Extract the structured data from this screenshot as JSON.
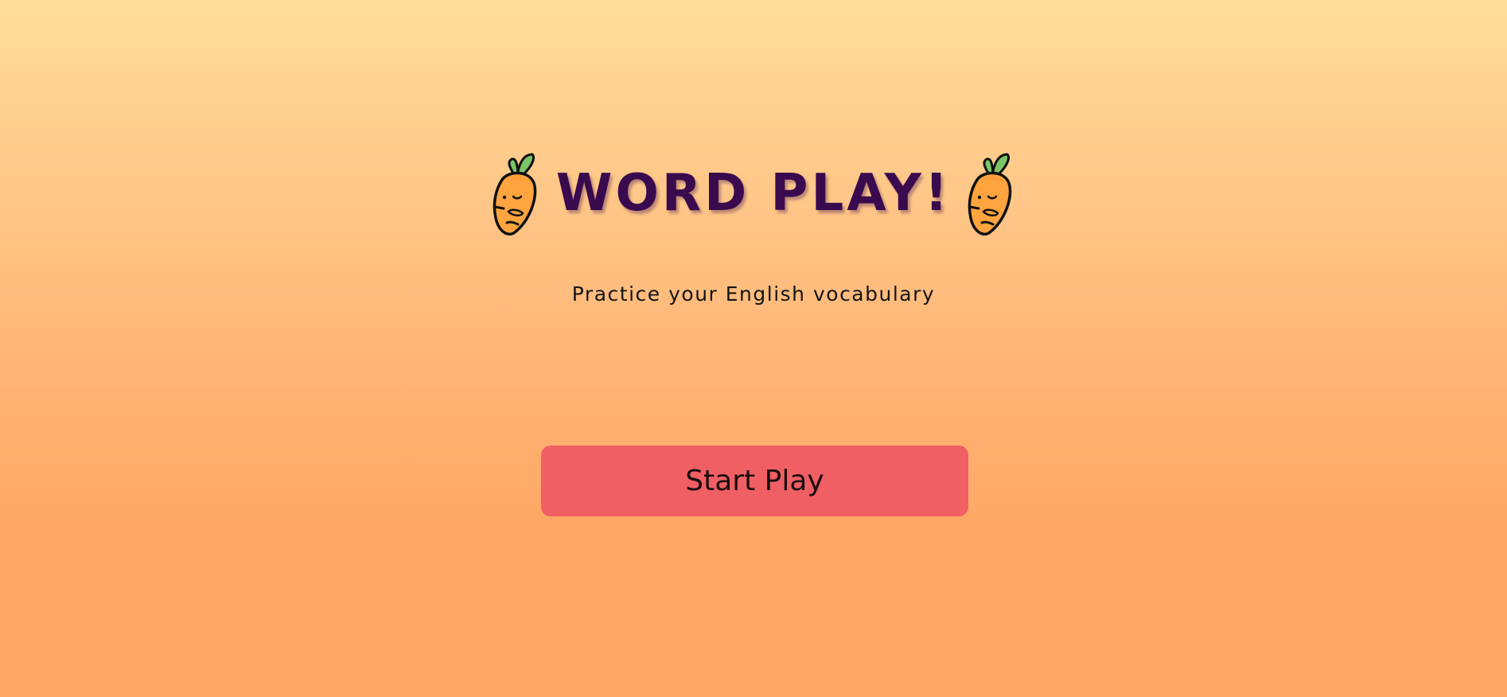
{
  "header": {
    "title": "WORD PLAY!",
    "left_icon": "carrot-icon",
    "right_icon": "carrot-icon"
  },
  "subtitle": "Practice your English vocabulary",
  "actions": {
    "start_label": "Start Play"
  },
  "colors": {
    "title": "#3a0a4f",
    "button": "#ef5f63",
    "background_top": "#ffdd99",
    "background_bottom": "#ffa865"
  }
}
